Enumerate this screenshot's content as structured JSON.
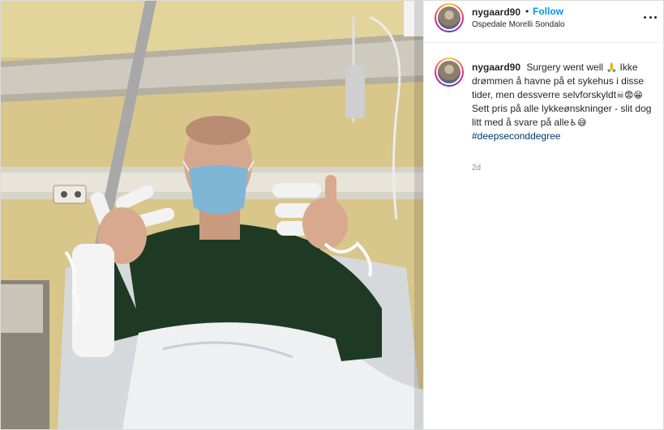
{
  "post": {
    "username": "nygaard90",
    "separator": "•",
    "follow_label": "Follow",
    "location": "Ospedale Morelli Sondalo",
    "more_icon": "more-horizontal-icon",
    "photo_alt": "Patient in hospital bed with bandaged hands giving thumbs up"
  },
  "caption": {
    "username": "nygaard90",
    "text_1": "Surgery went well",
    "emoji_pray": "🙏",
    "text_2": "Ikke drømmen å havne på et sykehus i disse tider, men dessverre selvforskyldt",
    "emoji_skull": "☠",
    "emoji_face1": "😨",
    "emoji_face2": "😁",
    "text_3": "Sett pris på alle lykkeønskninger - slit dog litt med å svare på alle",
    "emoji_wheelchair": "♿",
    "emoji_face3": "😅",
    "hashtag": "#deepseconddegree",
    "time": "2d"
  },
  "colors": {
    "accent": "#0095f6",
    "hashtag": "#00376b",
    "meta": "#8e8e8e"
  }
}
